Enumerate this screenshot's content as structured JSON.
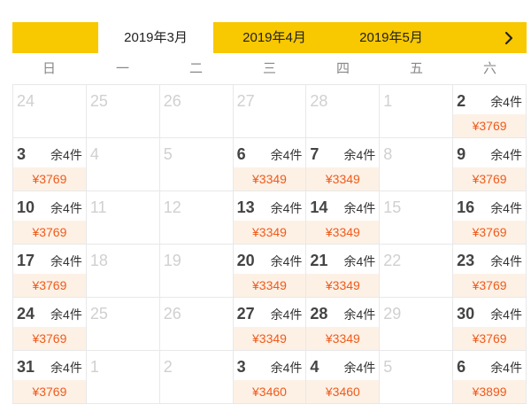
{
  "calendar": {
    "months": [
      {
        "label": "2019年3月",
        "active": true
      },
      {
        "label": "2019年4月",
        "active": false
      },
      {
        "label": "2019年5月",
        "active": false
      }
    ],
    "next_icon": "chevron-right-icon",
    "weekdays": [
      "日",
      "一",
      "二",
      "三",
      "四",
      "五",
      "六"
    ],
    "colors": {
      "accent": "#f8c800",
      "price": "#f05a1a",
      "price_bg": "#fdf1e6",
      "inactive_day": "#d0d0d0"
    },
    "days": [
      {
        "num": "24"
      },
      {
        "num": "25"
      },
      {
        "num": "26"
      },
      {
        "num": "27"
      },
      {
        "num": "28"
      },
      {
        "num": "1"
      },
      {
        "num": "2",
        "stock": "余4件",
        "price": "¥3769"
      },
      {
        "num": "3",
        "stock": "余4件",
        "price": "¥3769"
      },
      {
        "num": "4"
      },
      {
        "num": "5"
      },
      {
        "num": "6",
        "stock": "余4件",
        "price": "¥3349"
      },
      {
        "num": "7",
        "stock": "余4件",
        "price": "¥3349"
      },
      {
        "num": "8"
      },
      {
        "num": "9",
        "stock": "余4件",
        "price": "¥3769"
      },
      {
        "num": "10",
        "stock": "余4件",
        "price": "¥3769"
      },
      {
        "num": "11"
      },
      {
        "num": "12"
      },
      {
        "num": "13",
        "stock": "余4件",
        "price": "¥3349"
      },
      {
        "num": "14",
        "stock": "余4件",
        "price": "¥3349"
      },
      {
        "num": "15"
      },
      {
        "num": "16",
        "stock": "余4件",
        "price": "¥3769"
      },
      {
        "num": "17",
        "stock": "余4件",
        "price": "¥3769"
      },
      {
        "num": "18"
      },
      {
        "num": "19"
      },
      {
        "num": "20",
        "stock": "余4件",
        "price": "¥3349"
      },
      {
        "num": "21",
        "stock": "余4件",
        "price": "¥3349"
      },
      {
        "num": "22"
      },
      {
        "num": "23",
        "stock": "余4件",
        "price": "¥3769"
      },
      {
        "num": "24",
        "stock": "余4件",
        "price": "¥3769"
      },
      {
        "num": "25"
      },
      {
        "num": "26"
      },
      {
        "num": "27",
        "stock": "余4件",
        "price": "¥3349"
      },
      {
        "num": "28",
        "stock": "余4件",
        "price": "¥3349"
      },
      {
        "num": "29"
      },
      {
        "num": "30",
        "stock": "余4件",
        "price": "¥3769"
      },
      {
        "num": "31",
        "stock": "余4件",
        "price": "¥3769"
      },
      {
        "num": "1"
      },
      {
        "num": "2"
      },
      {
        "num": "3",
        "stock": "余4件",
        "price": "¥3460"
      },
      {
        "num": "4",
        "stock": "余4件",
        "price": "¥3460"
      },
      {
        "num": "5"
      },
      {
        "num": "6",
        "stock": "余4件",
        "price": "¥3899"
      }
    ]
  }
}
